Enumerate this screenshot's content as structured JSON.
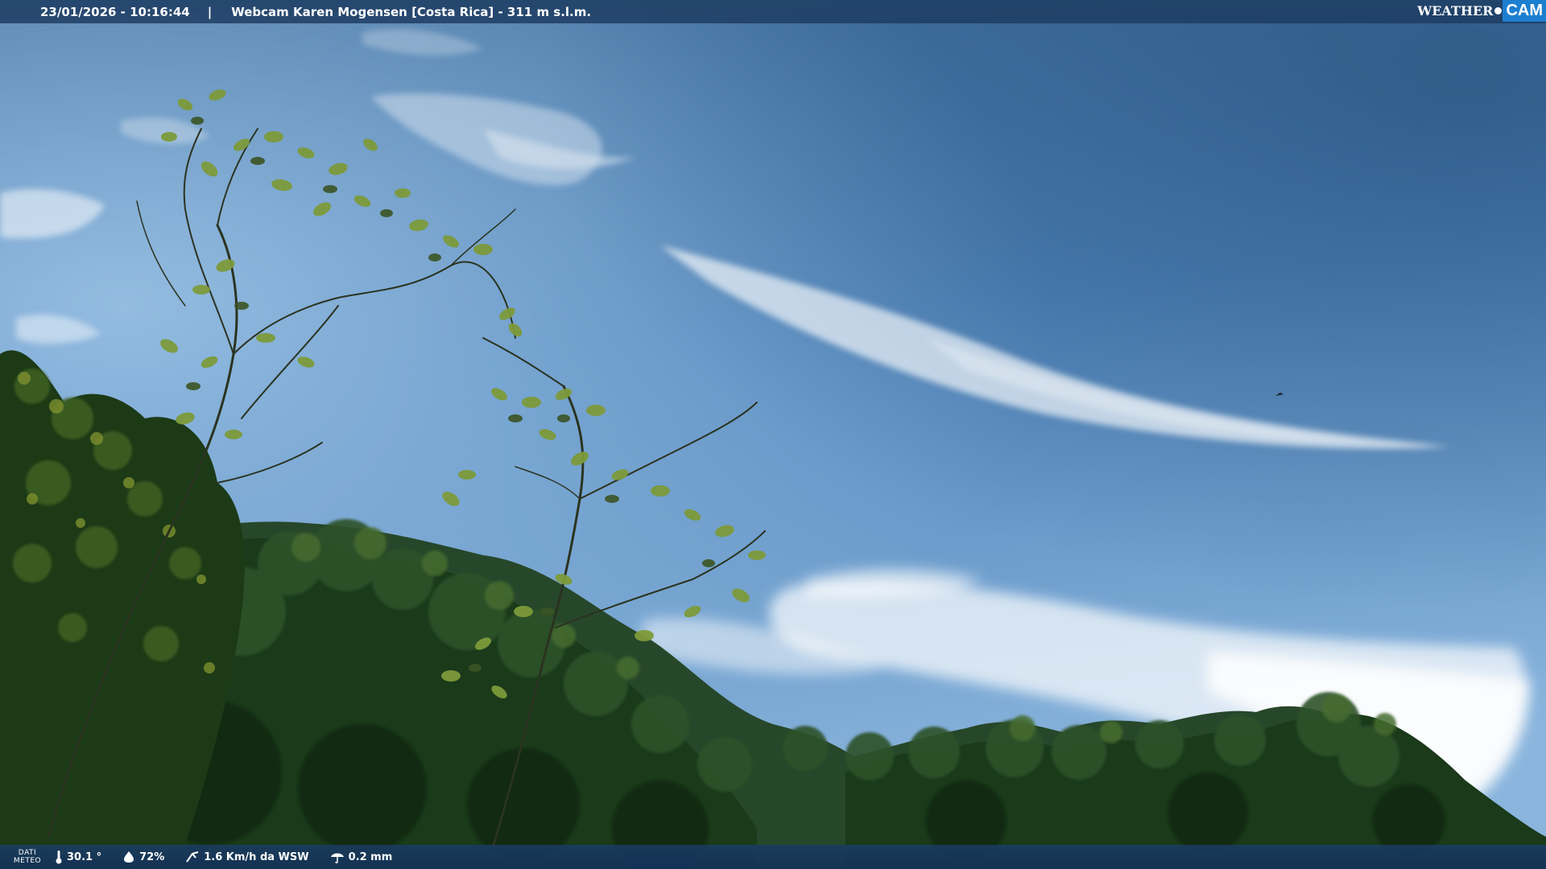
{
  "overlay_top": {
    "datetime": "23/01/2026 - 10:16:44",
    "separator": "|",
    "title": "Webcam Karen Mogensen [Costa Rica] - 311 m s.l.m."
  },
  "logo": {
    "part1": "WEATHER",
    "part2": "CAM"
  },
  "overlay_bottom": {
    "label_line1": "DATI",
    "label_line2": "METEO",
    "temperature": "30.1 °",
    "humidity": "72%",
    "wind": "1.6 Km/h da WSW",
    "rain": "0.2 mm"
  },
  "icons": {
    "temperature": "thermometer-icon",
    "humidity": "humidity-drop-icon",
    "wind": "wind-icon",
    "rain": "rain-umbrella-icon"
  },
  "colors": {
    "sky_top": "#355f8d",
    "sky_bottom": "#86aed6",
    "foliage_dark": "#1d3b17",
    "foliage_light": "#8a9a38",
    "logo_accent": "#1d7fd0"
  }
}
